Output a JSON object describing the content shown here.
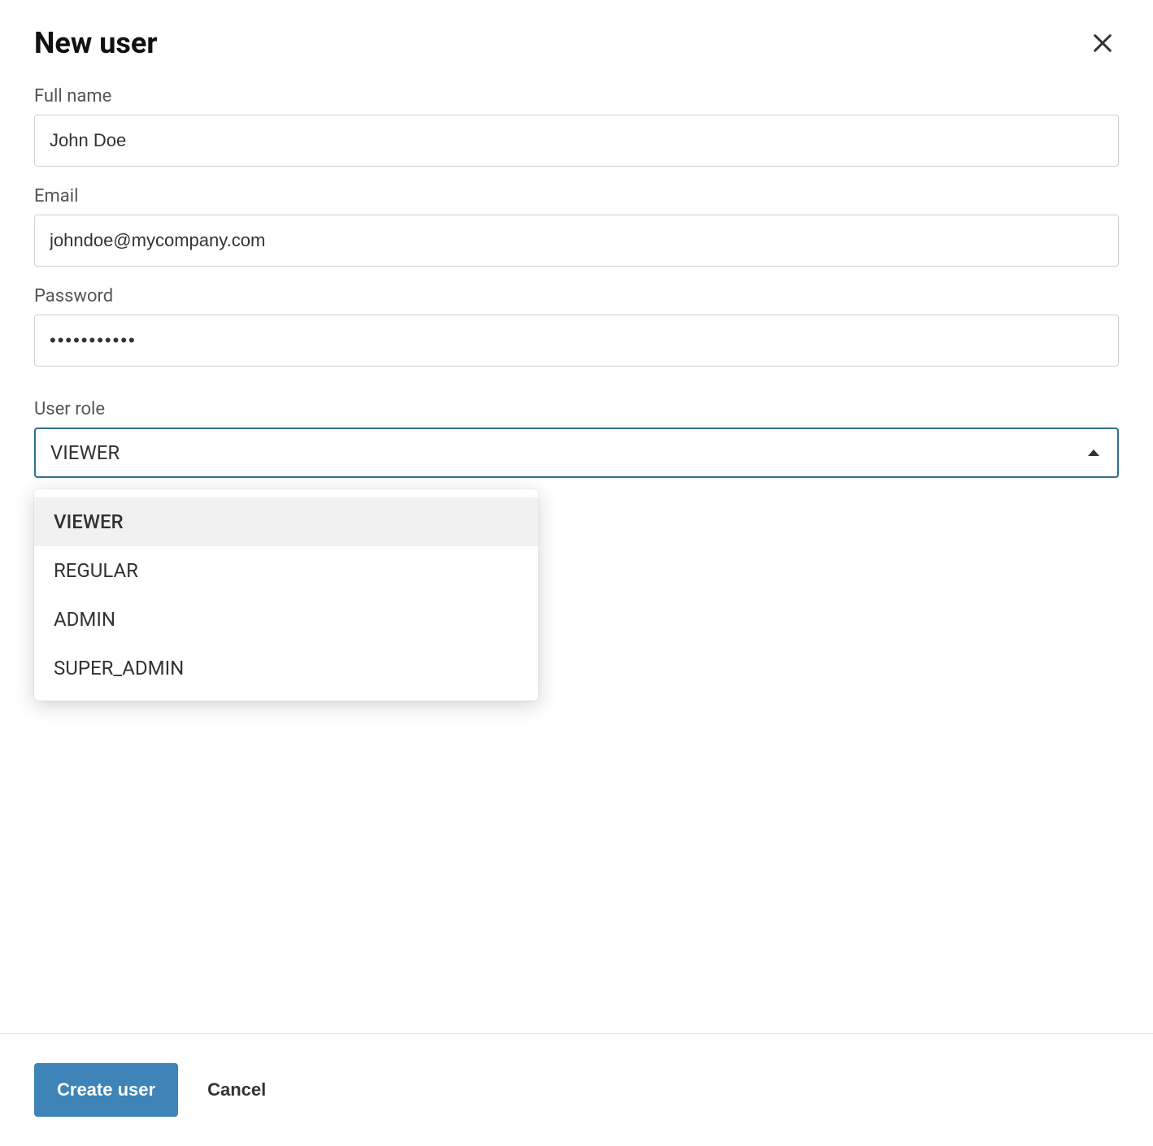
{
  "header": {
    "title": "New user"
  },
  "form": {
    "fullname": {
      "label": "Full name",
      "value": "John Doe"
    },
    "email": {
      "label": "Email",
      "value": "johndoe@mycompany.com"
    },
    "password": {
      "label": "Password",
      "value": "•••••••••••"
    },
    "role": {
      "label": "User role",
      "selected": "VIEWER",
      "options": [
        "VIEWER",
        "REGULAR",
        "ADMIN",
        "SUPER_ADMIN"
      ]
    }
  },
  "footer": {
    "create": "Create user",
    "cancel": "Cancel"
  }
}
